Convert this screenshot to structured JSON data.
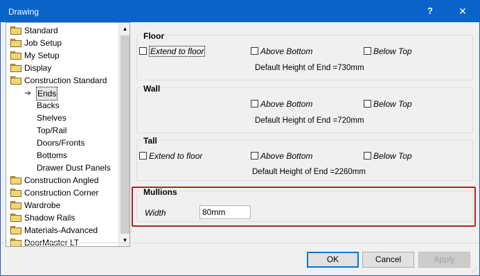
{
  "window": {
    "title": "Drawing",
    "help_glyph": "?",
    "close_glyph": "✕"
  },
  "tree": {
    "items": [
      {
        "label": "Standard",
        "type": "folder"
      },
      {
        "label": "Job Setup",
        "type": "folder"
      },
      {
        "label": "My Setup",
        "type": "folder"
      },
      {
        "label": "Display",
        "type": "folder"
      },
      {
        "label": "Construction Standard",
        "type": "folder"
      },
      {
        "label": "Ends",
        "type": "child-selected"
      },
      {
        "label": "Backs",
        "type": "child"
      },
      {
        "label": "Shelves",
        "type": "child"
      },
      {
        "label": "Top/Rail",
        "type": "child"
      },
      {
        "label": "Doors/Fronts",
        "type": "child"
      },
      {
        "label": "Bottoms",
        "type": "child"
      },
      {
        "label": "Drawer Dust Panels",
        "type": "child"
      },
      {
        "label": "Construction Angled",
        "type": "folder"
      },
      {
        "label": "Construction Corner",
        "type": "folder"
      },
      {
        "label": "Wardrobe",
        "type": "folder"
      },
      {
        "label": "Shadow Rails",
        "type": "folder"
      },
      {
        "label": "Materials-Advanced",
        "type": "folder"
      },
      {
        "label": "DoorMaster LT",
        "type": "folder"
      }
    ],
    "selected_arrow": "➔",
    "scroll_up": "▲",
    "scroll_down": "▼"
  },
  "floor": {
    "title": "Floor",
    "extend_to_floor": "Extend to floor",
    "above_bottom": "Above Bottom",
    "below_top": "Below Top",
    "default_height": "Default Height of End =730mm"
  },
  "wall": {
    "title": "Wall",
    "above_bottom": "Above Bottom",
    "below_top": "Below Top",
    "default_height": "Default Height of End =720mm"
  },
  "tall": {
    "title": "Tall",
    "extend_to_floor": "Extend to floor",
    "above_bottom": "Above Bottom",
    "below_top": "Below Top",
    "default_height": "Default Height of End =2260mm"
  },
  "mullions": {
    "title": "Mullions",
    "width_label": "Width",
    "width_value": "80mm"
  },
  "buttons": {
    "ok": "OK",
    "cancel": "Cancel",
    "apply": "Apply"
  },
  "colors": {
    "titlebar": "#0a63c9",
    "highlight_border": "#b22222",
    "folder": "#f3d673"
  }
}
